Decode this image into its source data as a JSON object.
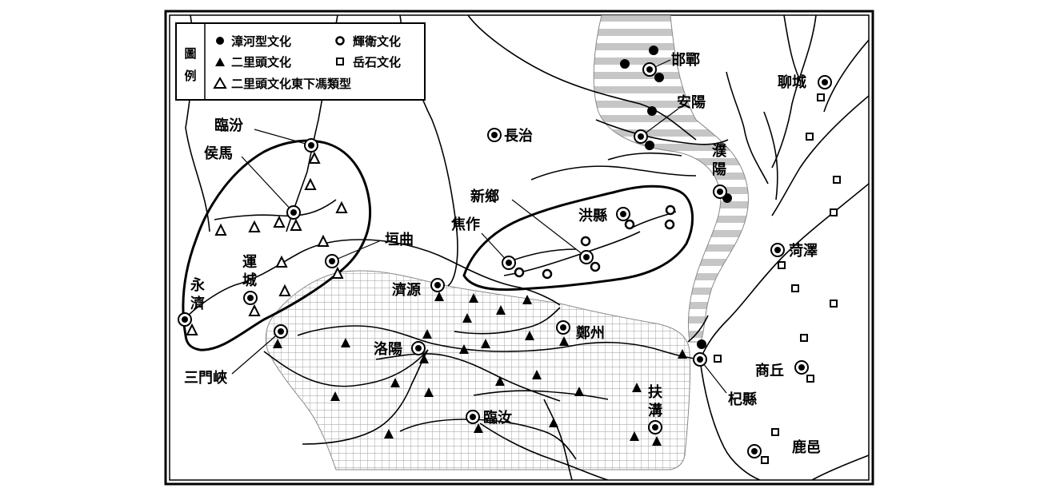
{
  "legend": {
    "title": "圖例",
    "entries": [
      {
        "symbol": "filled-circle",
        "label": "漳河型文化"
      },
      {
        "symbol": "open-circle",
        "label": "輝衛文化"
      },
      {
        "symbol": "filled-triangle",
        "label": "二里頭文化"
      },
      {
        "symbol": "open-square",
        "label": "岳石文化"
      },
      {
        "symbol": "open-triangle",
        "label": "二里頭文化東下馮類型"
      }
    ]
  },
  "places": {
    "handan": "邯鄲",
    "anyang": "安陽",
    "liaocheng": "聊城",
    "changzhi": "長治",
    "puyang": "濮陽",
    "linfen": "臨汾",
    "houma": "侯馬",
    "xinxiang": "新鄉",
    "hongxian": "洪縣",
    "jiaozuo": "焦作",
    "yuanqu": "垣曲",
    "yuncheng": "運城",
    "yongji": "永濟",
    "jiyuan": "濟源",
    "heze": "菏澤",
    "zhengzhou": "鄭州",
    "luoyang": "洛陽",
    "sanmenxia": "三門峽",
    "shangqiu": "商丘",
    "qixian": "杞縣",
    "fugou": "扶溝",
    "linru": "臨汝",
    "luyi": "鹿邑"
  }
}
